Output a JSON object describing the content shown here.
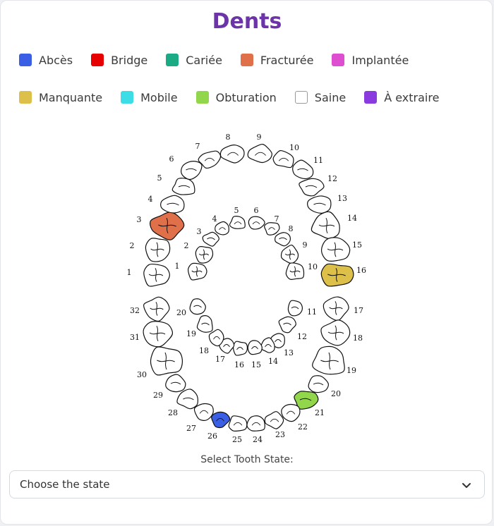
{
  "title": "Dents",
  "legend_rows": [
    [
      {
        "label": "Abcès",
        "color": "#3a5fe5"
      },
      {
        "label": "Bridge",
        "color": "#e60000"
      },
      {
        "label": "Cariée",
        "color": "#1aab85"
      },
      {
        "label": "Fracturée",
        "color": "#e0704a"
      },
      {
        "label": "Implantée",
        "color": "#dd4fd0"
      }
    ],
    [
      {
        "label": "Manquante",
        "color": "#dcc04a"
      },
      {
        "label": "Mobile",
        "color": "#3ddde8"
      },
      {
        "label": "Obturation",
        "color": "#92d64b"
      },
      {
        "label": "Saine",
        "color": "#ffffff"
      },
      {
        "label": "À extraire",
        "color": "#8a3be0"
      }
    ]
  ],
  "state_colors": {
    "Abcès": "#3a5fe5",
    "Fracturée": "#e0704a",
    "Manquante": "#dcc04a",
    "Obturation": "#92d64b",
    "Saine": "#ffffff"
  },
  "adult_teeth": [
    {
      "number": "1",
      "state": "Saine"
    },
    {
      "number": "2",
      "state": "Saine"
    },
    {
      "number": "3",
      "state": "Fracturée"
    },
    {
      "number": "4",
      "state": "Saine"
    },
    {
      "number": "5",
      "state": "Saine"
    },
    {
      "number": "6",
      "state": "Saine"
    },
    {
      "number": "7",
      "state": "Saine"
    },
    {
      "number": "8",
      "state": "Saine"
    },
    {
      "number": "9",
      "state": "Saine"
    },
    {
      "number": "10",
      "state": "Saine"
    },
    {
      "number": "11",
      "state": "Saine"
    },
    {
      "number": "12",
      "state": "Saine"
    },
    {
      "number": "13",
      "state": "Saine"
    },
    {
      "number": "14",
      "state": "Saine"
    },
    {
      "number": "15",
      "state": "Saine"
    },
    {
      "number": "16",
      "state": "Manquante"
    },
    {
      "number": "17",
      "state": "Saine"
    },
    {
      "number": "18",
      "state": "Saine"
    },
    {
      "number": "19",
      "state": "Saine"
    },
    {
      "number": "20",
      "state": "Saine"
    },
    {
      "number": "21",
      "state": "Obturation"
    },
    {
      "number": "22",
      "state": "Saine"
    },
    {
      "number": "23",
      "state": "Saine"
    },
    {
      "number": "24",
      "state": "Saine"
    },
    {
      "number": "25",
      "state": "Saine"
    },
    {
      "number": "26",
      "state": "Abcès"
    },
    {
      "number": "27",
      "state": "Saine"
    },
    {
      "number": "28",
      "state": "Saine"
    },
    {
      "number": "29",
      "state": "Saine"
    },
    {
      "number": "30",
      "state": "Saine"
    },
    {
      "number": "31",
      "state": "Saine"
    },
    {
      "number": "32",
      "state": "Saine"
    }
  ],
  "child_teeth": [
    {
      "number": "1",
      "state": "Saine"
    },
    {
      "number": "2",
      "state": "Saine"
    },
    {
      "number": "3",
      "state": "Saine"
    },
    {
      "number": "4",
      "state": "Saine"
    },
    {
      "number": "5",
      "state": "Saine"
    },
    {
      "number": "6",
      "state": "Saine"
    },
    {
      "number": "7",
      "state": "Saine"
    },
    {
      "number": "8",
      "state": "Saine"
    },
    {
      "number": "9",
      "state": "Saine"
    },
    {
      "number": "10",
      "state": "Saine"
    },
    {
      "number": "11",
      "state": "Saine"
    },
    {
      "number": "12",
      "state": "Saine"
    },
    {
      "number": "13",
      "state": "Saine"
    },
    {
      "number": "14",
      "state": "Saine"
    },
    {
      "number": "15",
      "state": "Saine"
    },
    {
      "number": "16",
      "state": "Saine"
    },
    {
      "number": "17",
      "state": "Saine"
    },
    {
      "number": "18",
      "state": "Saine"
    },
    {
      "number": "19",
      "state": "Saine"
    },
    {
      "number": "20",
      "state": "Saine"
    }
  ],
  "select": {
    "label": "Select Tooth State:",
    "value": "Choose the state",
    "icon": "chevron-down-icon"
  }
}
